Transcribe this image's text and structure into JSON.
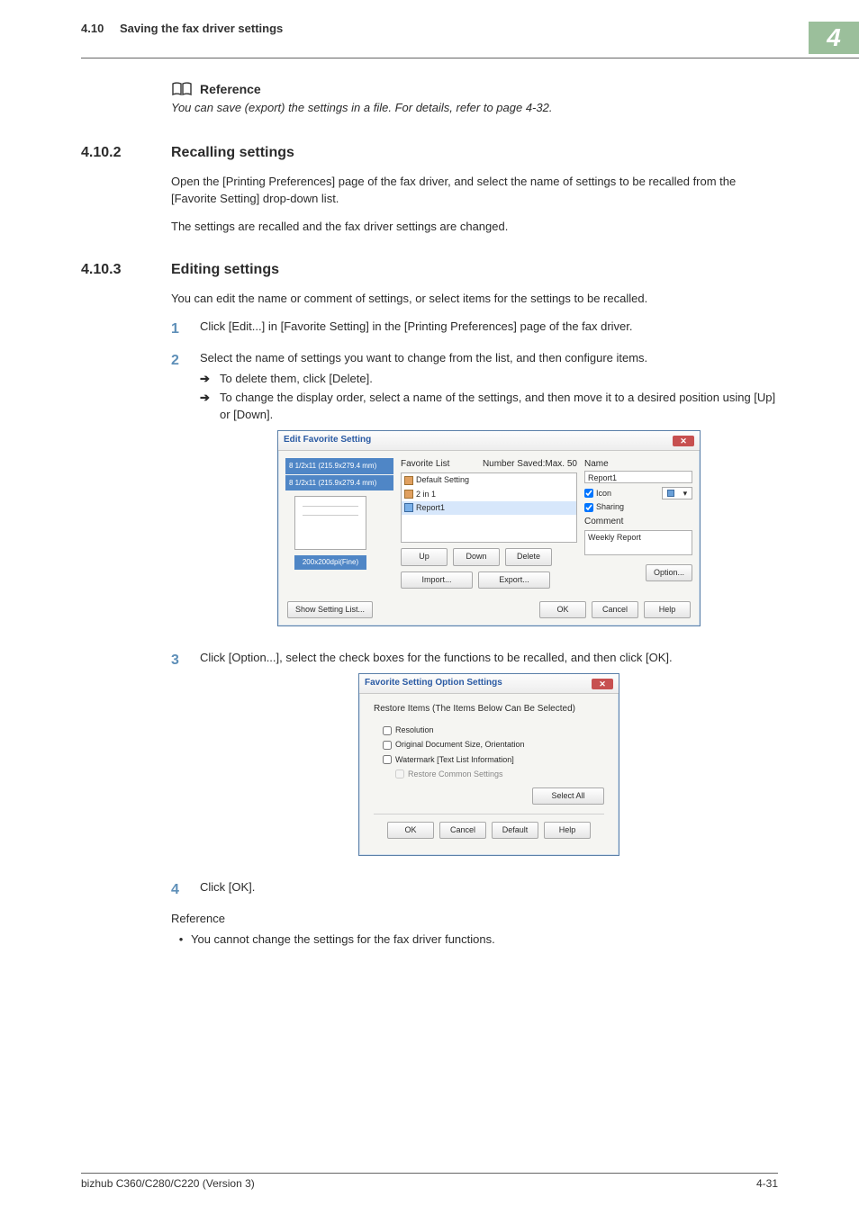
{
  "header": {
    "section_number": "4.10",
    "section_title": "Saving the fax driver settings",
    "corner_badge": "4"
  },
  "reference": {
    "label": "Reference",
    "body": "You can save (export) the settings in a file. For details, refer to page 4-32."
  },
  "h2a": {
    "num": "4.10.2",
    "title": "Recalling settings"
  },
  "p1": "Open the [Printing Preferences] page of the fax driver, and select the name of settings to be recalled from the [Favorite Setting] drop-down list.",
  "p2": "The settings are recalled and the fax driver settings are changed.",
  "h2b": {
    "num": "4.10.3",
    "title": "Editing settings"
  },
  "p3": "You can edit the name or comment of settings, or select items for the settings to be recalled.",
  "steps": {
    "s1": "Click [Edit...] in [Favorite Setting] in the [Printing Preferences] page of the fax driver.",
    "s2": "Select the name of settings you want to change from the list, and then configure items.",
    "s2a": "To delete them, click [Delete].",
    "s2b": "To change the display order, select a name of the settings, and then move it to a desired position using [Up] or [Down].",
    "s3": "Click [Option...], select the check boxes for the functions to be recalled, and then click [OK].",
    "s4": "Click [OK]."
  },
  "dlg1": {
    "title": "Edit Favorite Setting",
    "preview_size1": "8 1/2x11 (215.9x279.4 mm)",
    "preview_size2": "8 1/2x11 (215.9x279.4 mm)",
    "preview_res": "200x200dpi(Fine)",
    "fav_label": "Favorite List",
    "fav_count": "Number Saved:Max. 50",
    "favlist": {
      "i1": "Default Setting",
      "i2": "2 in 1",
      "i3": "Report1"
    },
    "up": "Up",
    "down": "Down",
    "delete": "Delete",
    "import": "Import...",
    "export": "Export...",
    "name_label": "Name",
    "name_value": "Report1",
    "icon_chk": "Icon",
    "sharing_chk": "Sharing",
    "comment_label": "Comment",
    "comment_value": "Weekly Report",
    "option": "Option...",
    "show_setting": "Show Setting List...",
    "ok": "OK",
    "cancel": "Cancel",
    "help": "Help"
  },
  "dlg2": {
    "title": "Favorite Setting Option Settings",
    "grp": "Restore Items (The Items Below Can Be Selected)",
    "c1": "Resolution",
    "c2": "Original Document Size, Orientation",
    "c3": "Watermark [Text List Information]",
    "c4": "Restore Common Settings",
    "selectall": "Select All",
    "ok": "OK",
    "cancel": "Cancel",
    "default": "Default",
    "help": "Help"
  },
  "ref2": "Reference",
  "bullet1": "You cannot change the settings for the fax driver functions.",
  "footer": {
    "left": "bizhub C360/C280/C220 (Version 3)",
    "right": "4-31"
  }
}
